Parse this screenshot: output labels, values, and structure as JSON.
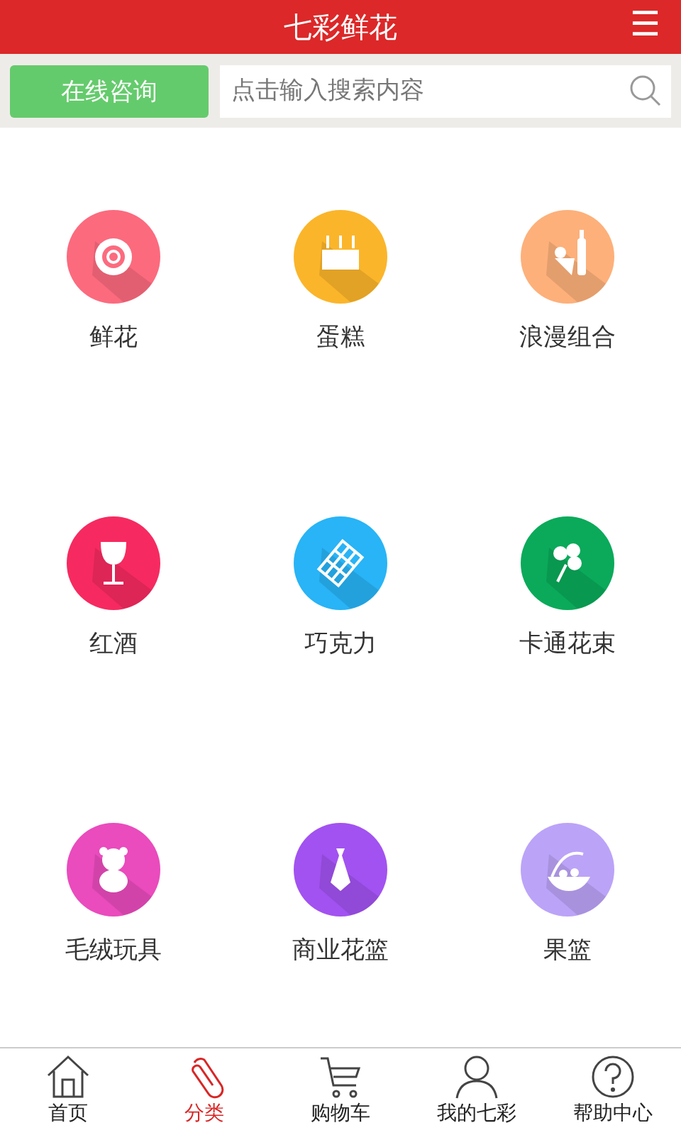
{
  "header": {
    "title": "七彩鲜花",
    "menu_icon": "☰"
  },
  "consult_button": "在线咨询",
  "search": {
    "placeholder": "点击输入搜索内容"
  },
  "categories": [
    {
      "label": "鲜花",
      "color": "#fc6a7e"
    },
    {
      "label": "蛋糕",
      "color": "#fbb52a"
    },
    {
      "label": "浪漫组合",
      "color": "#fdb07a"
    },
    {
      "label": "红酒",
      "color": "#f62a60"
    },
    {
      "label": "巧克力",
      "color": "#28b4f6"
    },
    {
      "label": "卡通花束",
      "color": "#0aaa5a"
    },
    {
      "label": "毛绒玩具",
      "color": "#ea4bbd"
    },
    {
      "label": "商业花篮",
      "color": "#a252f0"
    },
    {
      "label": "果篮",
      "color": "#bba3f8"
    }
  ],
  "tabs": [
    {
      "label": "首页",
      "selected": false
    },
    {
      "label": "分类",
      "selected": true
    },
    {
      "label": "购物车",
      "selected": false
    },
    {
      "label": "我的七彩",
      "selected": false
    },
    {
      "label": "帮助中心",
      "selected": false
    }
  ]
}
